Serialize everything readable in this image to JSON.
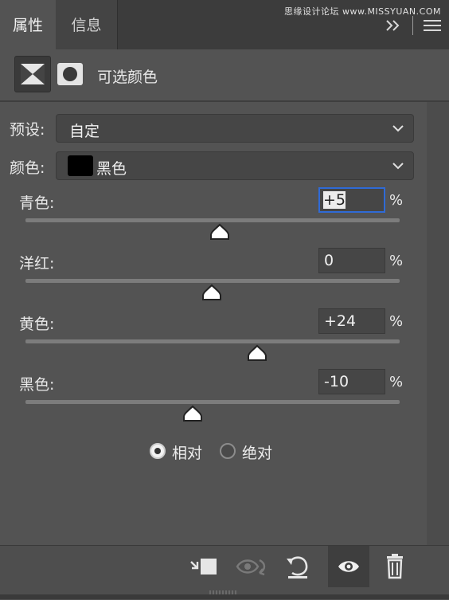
{
  "tabs": [
    {
      "label": "属性",
      "active": true
    },
    {
      "label": "信息",
      "active": false
    }
  ],
  "watermark": "思缘设计论坛 www.MISSYUAN.COM",
  "header": {
    "title": "可选颜色"
  },
  "preset": {
    "label": "预设:",
    "value": "自定"
  },
  "color": {
    "label": "颜色:",
    "value": "黑色",
    "swatch": "#000000"
  },
  "sliders": [
    {
      "label": "青色:",
      "value": "+5",
      "unit": "%",
      "level": 0.52
    },
    {
      "label": "洋红:",
      "value": "0",
      "unit": "%",
      "level": 0.497
    },
    {
      "label": "黄色:",
      "value": "+24",
      "unit": "%",
      "level": 0.62
    },
    {
      "label": "黑色:",
      "value": "-10",
      "unit": "%",
      "level": 0.447
    }
  ],
  "method": {
    "options": [
      "相对",
      "绝对"
    ],
    "selected": "相对"
  },
  "icons": {
    "clip": "clip-to-layer-icon",
    "view_prev": "view-previous-state-icon",
    "reset": "reset-icon",
    "visibility": "visibility-eye-icon",
    "delete": "trash-icon",
    "panel_menu": "panel-menu-icon",
    "collapse": "double-chevron-icon"
  },
  "colors": {
    "panel": "#535353",
    "tabbar": "#3c3c3c",
    "focus": "#2f6ad6"
  }
}
